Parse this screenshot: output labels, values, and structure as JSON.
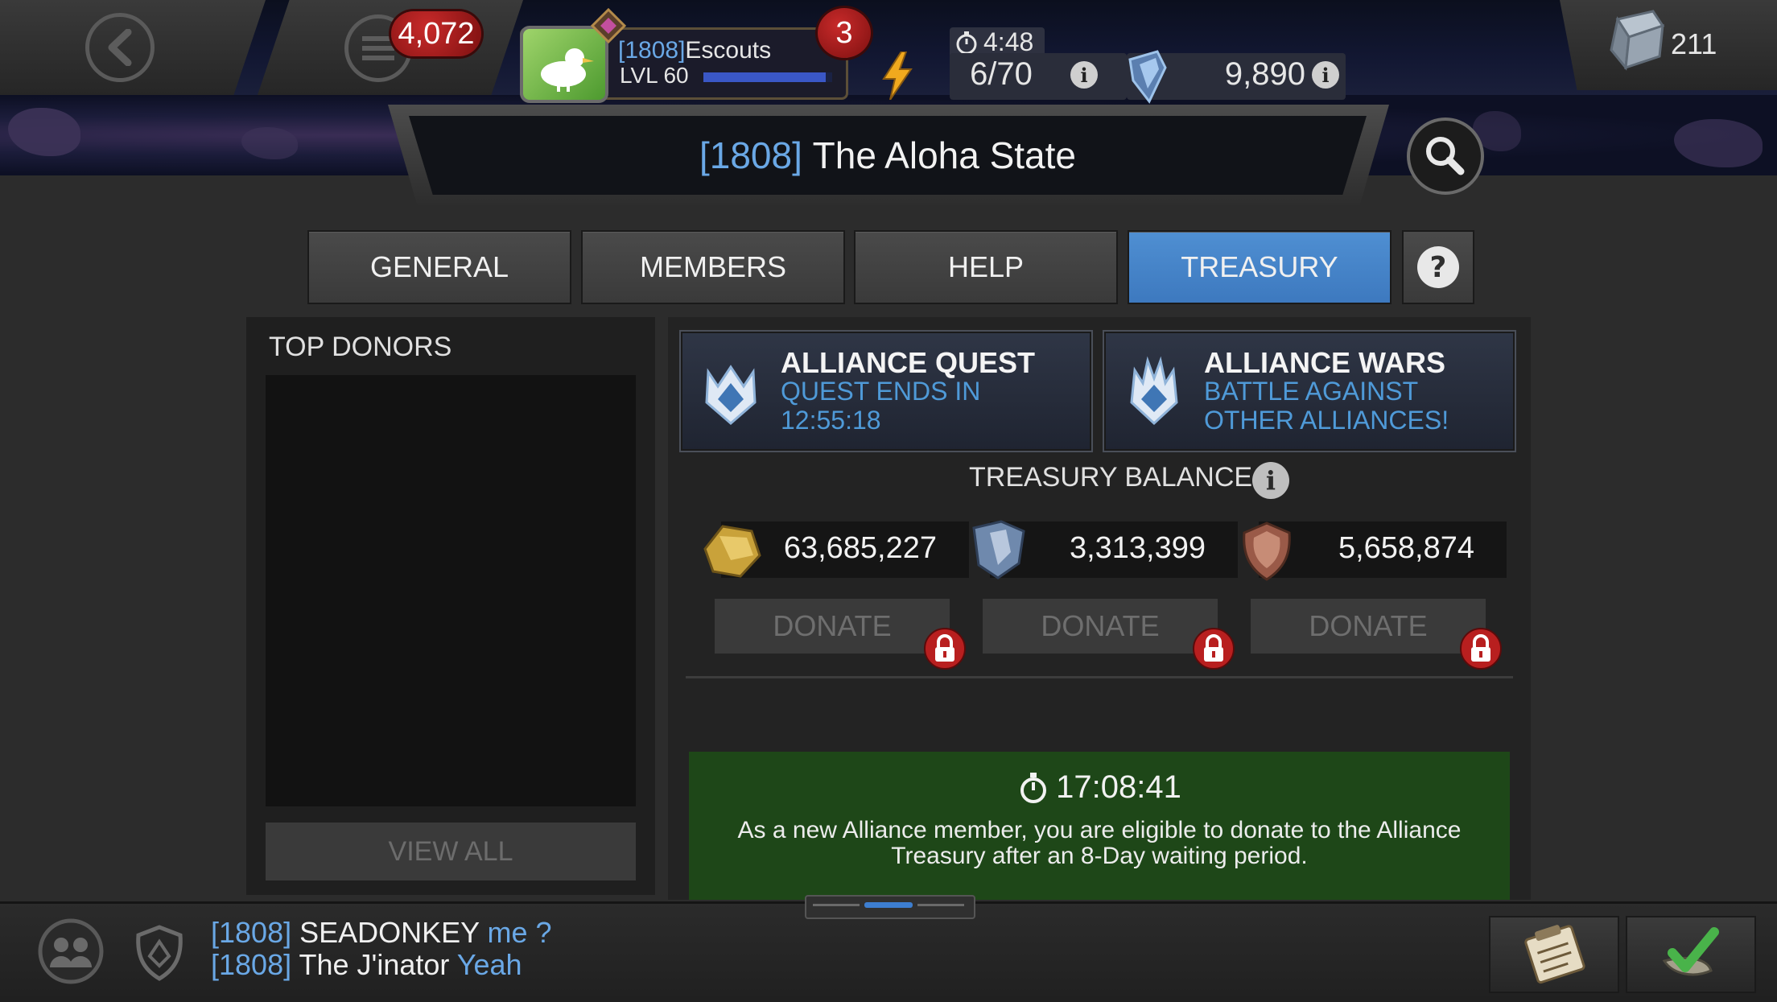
{
  "header": {
    "notification_count": "4,072",
    "profile_badge_count": "3",
    "profile_tag": "[1808]",
    "profile_name": "Escouts",
    "profile_level": "LVL 60",
    "xp_progress": 0.95,
    "energy_timer": "4:48",
    "energy": "6/70",
    "crystals": "9,890",
    "gold_units": "211"
  },
  "alliance": {
    "tag": "[1808]",
    "name": "The Aloha State"
  },
  "tabs": [
    {
      "label": "GENERAL",
      "active": false
    },
    {
      "label": "MEMBERS",
      "active": false
    },
    {
      "label": "HELP",
      "active": false
    },
    {
      "label": "TREASURY",
      "active": true
    }
  ],
  "top_donors": {
    "title": "TOP DONORS",
    "view_all_label": "VIEW ALL"
  },
  "quests": [
    {
      "title": "ALLIANCE QUEST",
      "subtitle_line1": "QUEST ENDS IN",
      "subtitle_line2": "12:55:18"
    },
    {
      "title": "ALLIANCE WARS",
      "subtitle_line1": "BATTLE AGAINST",
      "subtitle_line2": "OTHER ALLIANCES!"
    }
  ],
  "treasury": {
    "balance_label": "TREASURY BALANCE",
    "currencies": [
      {
        "icon": "gold-icon",
        "value": "63,685,227",
        "donate_label": "DONATE"
      },
      {
        "icon": "battlechip-icon",
        "value": "3,313,399",
        "donate_label": "DONATE"
      },
      {
        "icon": "loyalty-icon",
        "value": "5,658,874",
        "donate_label": "DONATE"
      }
    ]
  },
  "notice": {
    "timer": "17:08:41",
    "text": "As a new Alliance member, you are eligible to donate to the Alliance Treasury after an 8-Day waiting period."
  },
  "chat": [
    {
      "tag": "[1808]",
      "name": "SEADONKEY",
      "message": "me ?"
    },
    {
      "tag": "[1808]",
      "name": "The J'inator",
      "message": "Yeah"
    }
  ],
  "colors": {
    "accent_blue": "#4f8fd2",
    "tag_blue": "#6aa8e6",
    "notice_green": "#1e4718",
    "badge_red": "#b81f1f"
  }
}
